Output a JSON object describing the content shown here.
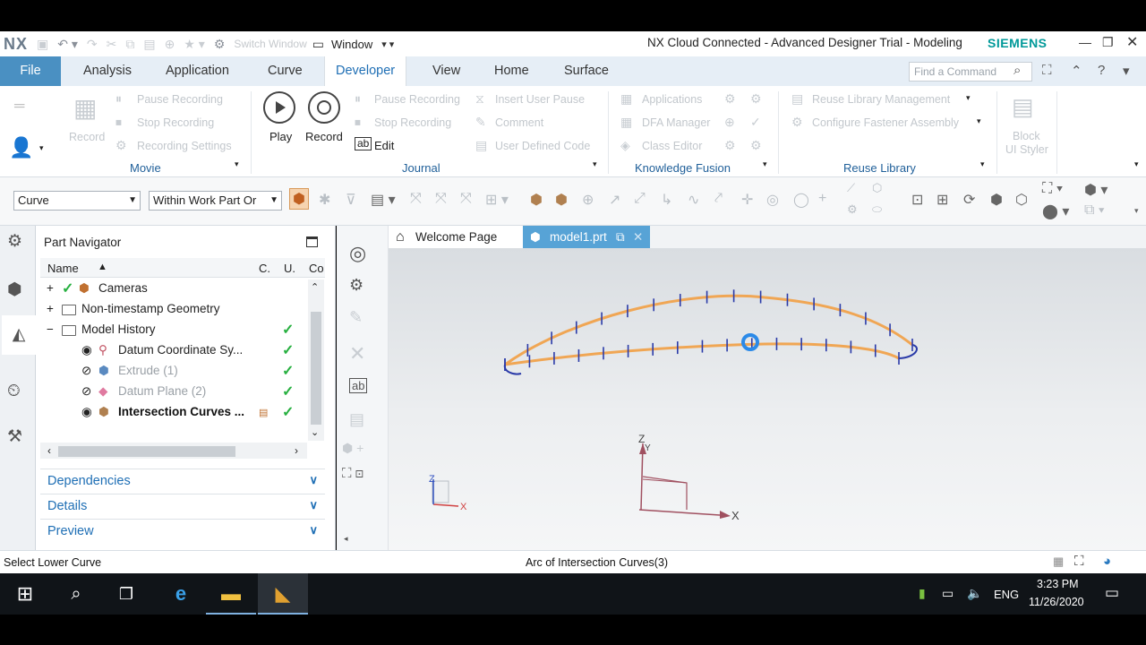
{
  "titlebar": {
    "logo": "NX",
    "switch_window": "Switch Window",
    "window_menu": "Window",
    "title": "NX Cloud Connected - Advanced Designer Trial - Modeling",
    "brand": "SIEMENS"
  },
  "tabs": [
    {
      "label": "File"
    },
    {
      "label": "Analysis"
    },
    {
      "label": "Application"
    },
    {
      "label": "Curve"
    },
    {
      "label": "Developer"
    },
    {
      "label": "View"
    },
    {
      "label": "Home"
    },
    {
      "label": "Surface"
    }
  ],
  "search": {
    "placeholder": "Find a Command"
  },
  "ribbon": {
    "movie": {
      "record_disabled": "Record",
      "pause": "Pause Recording",
      "stop": "Stop Recording",
      "settings": "Recording Settings",
      "group": "Movie"
    },
    "journal": {
      "play": "Play",
      "record": "Record",
      "edit": "Edit",
      "pause": "Pause Recording",
      "stop": "Stop Recording",
      "insert_pause": "Insert User Pause",
      "comment": "Comment",
      "user_code": "User Defined Code",
      "group": "Journal"
    },
    "knowledge": {
      "applications": "Applications",
      "dfa": "DFA Manager",
      "class_editor": "Class Editor",
      "group": "Knowledge Fusion"
    },
    "reuse": {
      "manage": "Reuse Library Management",
      "configure": "Configure Fastener Assembly",
      "group": "Reuse Library"
    },
    "block": {
      "line1": "Block",
      "line2": "UI Styler"
    }
  },
  "selection": {
    "filter": "Curve",
    "scope": "Within Work Part Or"
  },
  "navigator": {
    "title": "Part Navigator",
    "columns": {
      "name": "Name",
      "c": "C.",
      "u": "U.",
      "co": "Co"
    },
    "rows": [
      {
        "label": "Cameras"
      },
      {
        "label": "Non-timestamp Geometry"
      },
      {
        "label": "Model History"
      },
      {
        "label": "Datum Coordinate Sy..."
      },
      {
        "label": "Extrude (1)"
      },
      {
        "label": "Datum Plane (2)"
      },
      {
        "label": "Intersection Curves ..."
      }
    ],
    "panels": [
      {
        "label": "Dependencies"
      },
      {
        "label": "Details"
      },
      {
        "label": "Preview"
      }
    ]
  },
  "doc_tabs": [
    {
      "label": "Welcome Page"
    },
    {
      "label": "model1.prt"
    }
  ],
  "viewport": {
    "axis_x": "X",
    "axis_z": "Z",
    "axis_y": "Y",
    "triad_x": "X",
    "triad_z": "Z"
  },
  "status": {
    "prompt": "Select Lower Curve",
    "selection": "Arc of Intersection Curves(3)"
  },
  "taskbar": {
    "lang": "ENG",
    "time": "3:23 PM",
    "date": "11/26/2020"
  },
  "colors": {
    "accent": "#1f6fb5",
    "file_tab": "#4a90c2",
    "brand": "#009999",
    "curve": "#f0a654",
    "check": "#27b040"
  }
}
